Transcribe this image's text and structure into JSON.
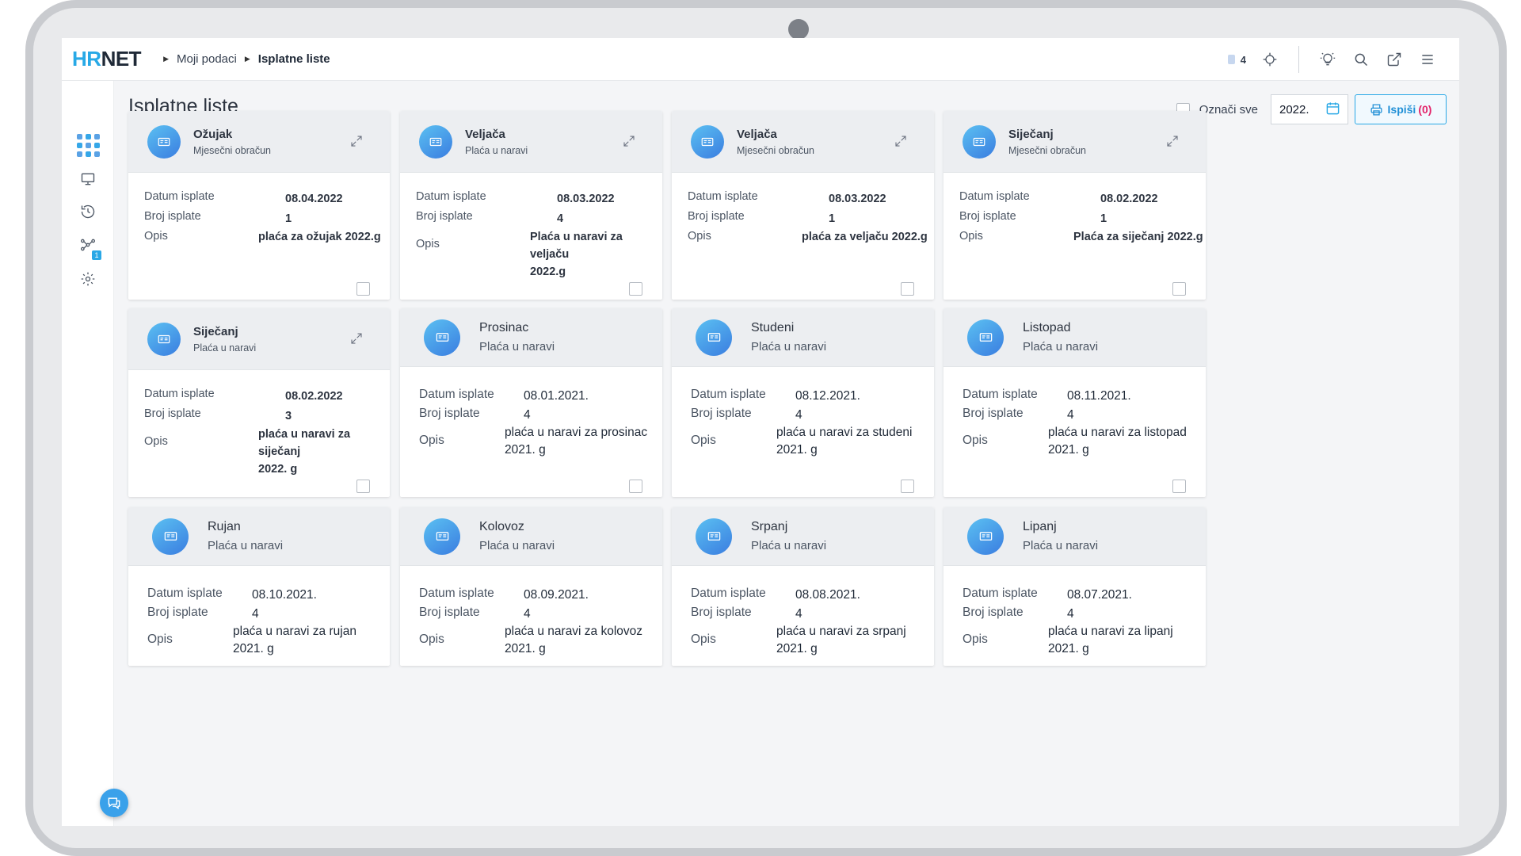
{
  "app": {
    "logo_hr": "HR",
    "logo_net": "NET"
  },
  "breadcrumb": [
    "Moji podaci",
    "Isplatne liste"
  ],
  "topbar": {
    "notification_count": "4"
  },
  "page": {
    "title": "Isplatne liste",
    "select_all_label": "Označi sve",
    "year_value": "2022.",
    "print_label": "Ispiši",
    "print_count": "(0)"
  },
  "labels": {
    "date": "Datum isplate",
    "number": "Broj isplate",
    "desc": "Opis"
  },
  "cards": [
    {
      "month": "Ožujak",
      "type": "Mjesečni obračun",
      "date": "08.04.2022",
      "number": "1",
      "desc": [
        "plaća za ožujak 2022.g"
      ]
    },
    {
      "month": "Veljača",
      "type": "Plaća u naravi",
      "date": "08.03.2022",
      "number": "4",
      "desc": [
        "Plaća u naravi za veljaču",
        "2022.g"
      ]
    },
    {
      "month": "Veljača",
      "type": "Mjesečni obračun",
      "date": "08.03.2022",
      "number": "1",
      "desc": [
        "plaća za veljaču 2022.g"
      ]
    },
    {
      "month": "Siječanj",
      "type": "Mjesečni obračun",
      "date": "08.02.2022",
      "number": "1",
      "desc": [
        "Plaća za siječanj 2022.g"
      ]
    },
    {
      "month": "Siječanj",
      "type": "Plaća u naravi",
      "date": "08.02.2022",
      "number": "3",
      "desc": [
        "plaća u naravi za siječanj",
        "2022. g"
      ]
    },
    {
      "month": "Prosinac",
      "type": "Plaća u naravi",
      "date": "08.01.2021.",
      "number": "4",
      "desc": [
        "plaća u naravi za prosinac",
        "2021. g"
      ]
    },
    {
      "month": "Studeni",
      "type": "Plaća u naravi",
      "date": "08.12.2021.",
      "number": "4",
      "desc": [
        "plaća u naravi za studeni",
        "2021. g"
      ]
    },
    {
      "month": "Listopad",
      "type": "Plaća u naravi",
      "date": "08.11.2021.",
      "number": "4",
      "desc": [
        "plaća u naravi za listopad",
        "2021. g"
      ]
    },
    {
      "month": "Rujan",
      "type": "Plaća u naravi",
      "date": "08.10.2021.",
      "number": "4",
      "desc": [
        "plaća u naravi za rujan",
        "2021. g"
      ]
    },
    {
      "month": "Kolovoz",
      "type": "Plaća u naravi",
      "date": "08.09.2021.",
      "number": "4",
      "desc": [
        "plaća u naravi za kolovoz",
        "2021. g"
      ]
    },
    {
      "month": "Srpanj",
      "type": "Plaća u naravi",
      "date": "08.08.2021.",
      "number": "4",
      "desc": [
        "plaća u naravi za srpanj",
        "2021. g"
      ]
    },
    {
      "month": "Lipanj",
      "type": "Plaća u naravi",
      "date": "08.07.2021.",
      "number": "4",
      "desc": [
        "plaća u naravi za lipanj",
        "2021. g"
      ]
    }
  ],
  "icons": {
    "topbar": [
      "notification-icon",
      "target-icon",
      "lightbulb-icon",
      "search-icon",
      "external-link-icon",
      "menu-icon"
    ],
    "sidebar": [
      "apps-grid-icon",
      "monitor-icon",
      "history-icon",
      "org-chart-icon",
      "settings-icon"
    ],
    "card": [
      "payslip-icon",
      "expand-icon"
    ]
  },
  "colors": {
    "accent": "#29a8e6",
    "print_count": "#e3246a"
  }
}
